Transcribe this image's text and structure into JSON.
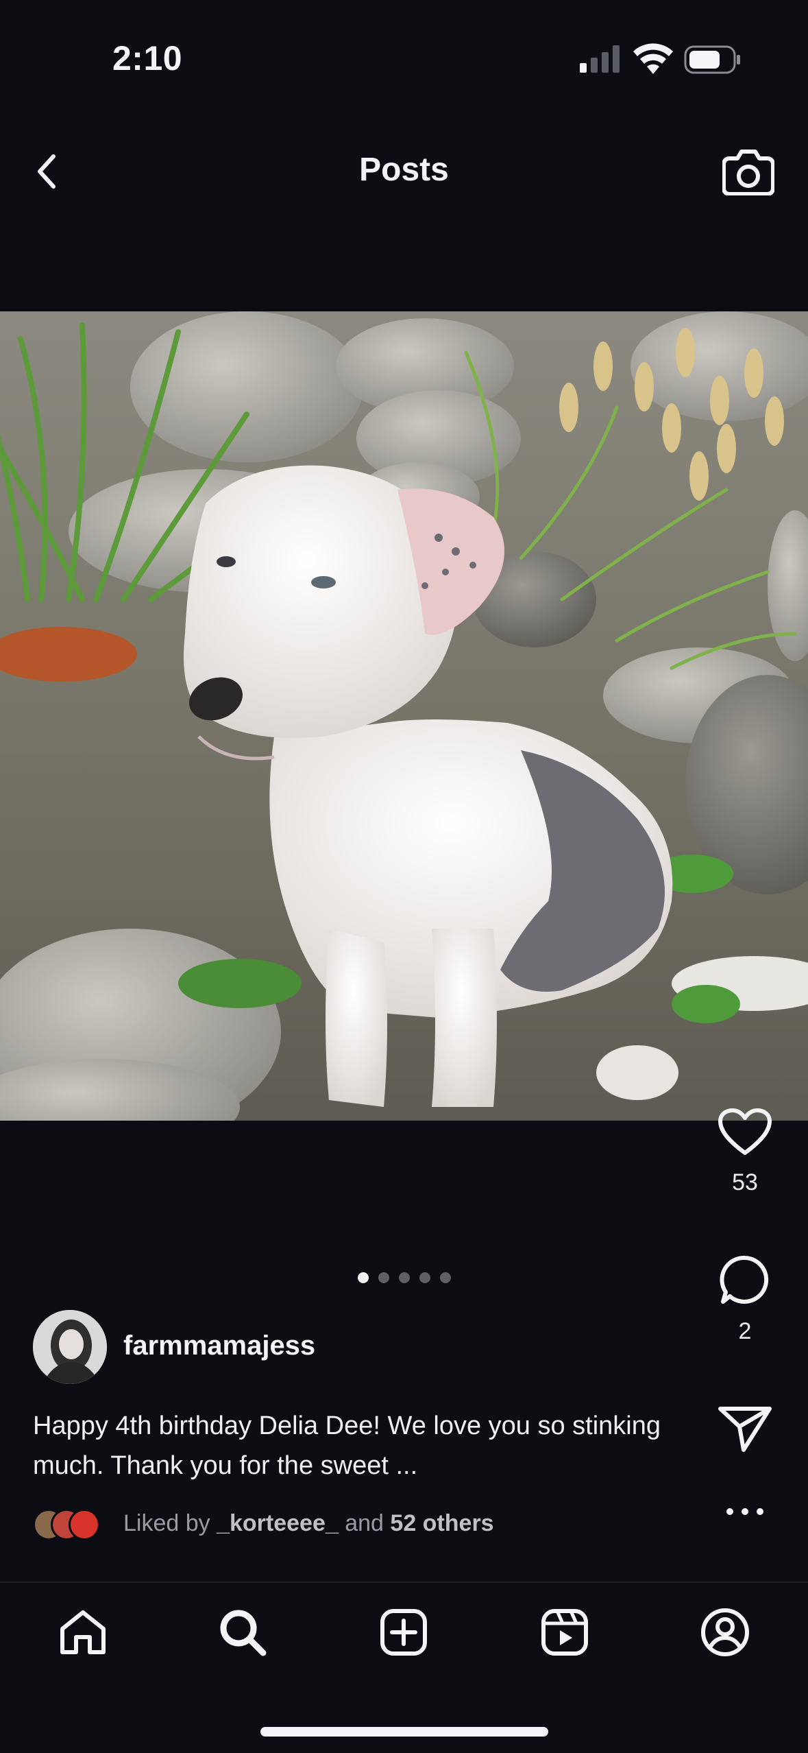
{
  "status_bar": {
    "time": "2:10",
    "icons": [
      "cellular-signal-icon",
      "wifi-icon",
      "battery-icon"
    ]
  },
  "header": {
    "title": "Posts",
    "back_icon": "chevron-left-icon",
    "camera_icon": "camera-icon"
  },
  "post": {
    "image_description_icon": "photo",
    "carousel": {
      "count": 5,
      "active_index": 0
    },
    "author": {
      "username": "farmmamajess"
    },
    "caption": "Happy 4th birthday Delia Dee! We love you so stinking much. Thank you for the sweet ...",
    "actions": {
      "likes": "53",
      "comments": "2",
      "share_icon": "paper-plane-icon",
      "more_icon": "more-horizontal-icon"
    },
    "liked_by": {
      "prefix": "Liked by",
      "user": "_korteeee_",
      "connector": "and",
      "others": "52 others"
    }
  },
  "bottom_nav": {
    "items": [
      "home-icon",
      "search-icon",
      "create-icon",
      "reels-icon",
      "profile-icon"
    ],
    "active": "search-icon"
  },
  "colors": {
    "background": "#0b0d13",
    "text": "#f4f4f6",
    "muted_text": "#9a9ca3"
  }
}
